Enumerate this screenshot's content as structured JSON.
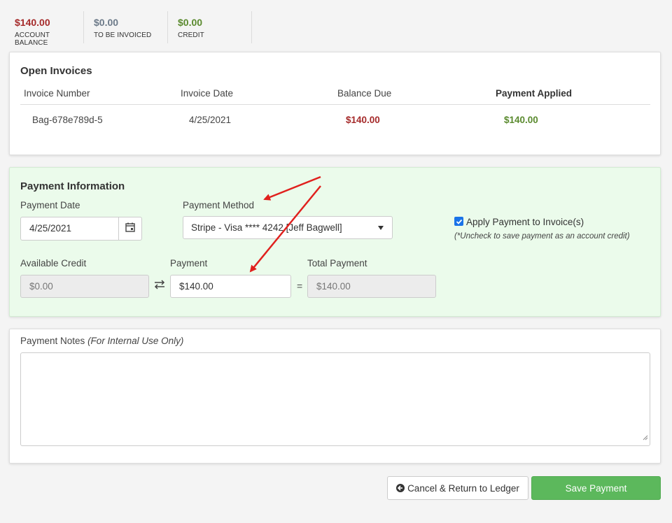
{
  "summary": [
    {
      "value": "$140.00",
      "label": "ACCOUNT BALANCE"
    },
    {
      "value": "$0.00",
      "label": "TO BE INVOICED"
    },
    {
      "value": "$0.00",
      "label": "CREDIT"
    }
  ],
  "invoices": {
    "title": "Open Invoices",
    "headers": [
      "Invoice Number",
      "Invoice Date",
      "Balance Due",
      "Payment Applied"
    ],
    "rows": [
      {
        "number": "Bag-678e789d-5",
        "date": "4/25/2021",
        "balance_due": "$140.00",
        "payment_applied": "$140.00"
      }
    ]
  },
  "payment": {
    "title": "Payment Information",
    "date_label": "Payment Date",
    "date_value": "4/25/2021",
    "method_label": "Payment Method",
    "method_value": "Stripe - Visa **** 4242 [Jeff Bagwell]",
    "apply_label": "Apply Payment to Invoice(s)",
    "apply_checked": true,
    "apply_hint": "(*Uncheck to save payment as an account credit)",
    "credit_label": "Available Credit",
    "credit_value": "$0.00",
    "payment_label": "Payment",
    "payment_value": "$140.00",
    "total_label": "Total Payment",
    "total_value": "$140.00",
    "equals": "="
  },
  "notes": {
    "label": "Payment Notes",
    "label_note": "(For Internal Use Only)",
    "value": ""
  },
  "actions": {
    "cancel_label": "Cancel & Return to Ledger",
    "save_label": "Save Payment"
  },
  "colors": {
    "balance": "#a52a2a",
    "credit": "#5a8a2e",
    "panel_green": "#ebfbeb",
    "save_button": "#5cb85c",
    "checkbox": "#1a73e8",
    "annotation_arrow": "#e0201d"
  },
  "icons": {
    "calendar": "calendar-icon",
    "swap": "swap-arrows-icon",
    "cancel": "circle-arrow-left-icon",
    "dropdown": "caret-down-icon"
  }
}
